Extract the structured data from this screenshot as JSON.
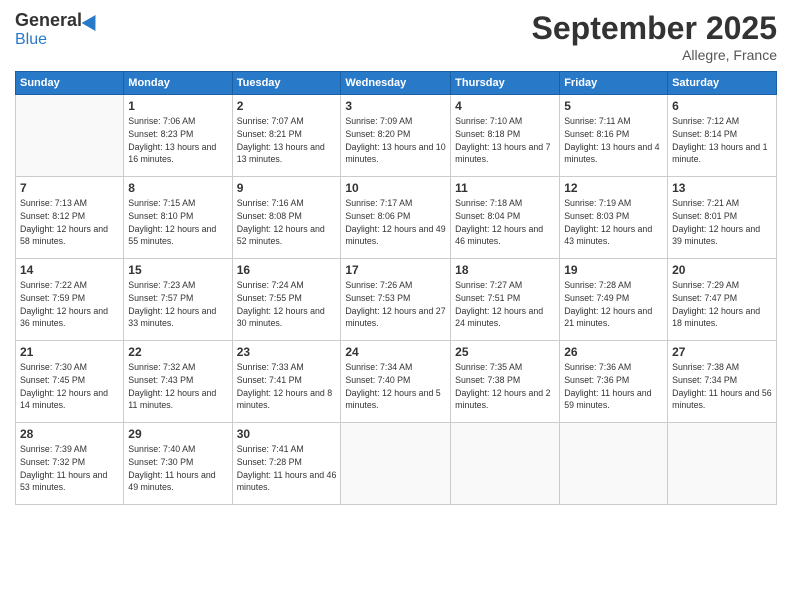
{
  "logo": {
    "general": "General",
    "blue": "Blue"
  },
  "header": {
    "month": "September 2025",
    "location": "Allegre, France"
  },
  "weekdays": [
    "Sunday",
    "Monday",
    "Tuesday",
    "Wednesday",
    "Thursday",
    "Friday",
    "Saturday"
  ],
  "weeks": [
    [
      {
        "day": "",
        "sunrise": "",
        "sunset": "",
        "daylight": ""
      },
      {
        "day": "1",
        "sunrise": "Sunrise: 7:06 AM",
        "sunset": "Sunset: 8:23 PM",
        "daylight": "Daylight: 13 hours and 16 minutes."
      },
      {
        "day": "2",
        "sunrise": "Sunrise: 7:07 AM",
        "sunset": "Sunset: 8:21 PM",
        "daylight": "Daylight: 13 hours and 13 minutes."
      },
      {
        "day": "3",
        "sunrise": "Sunrise: 7:09 AM",
        "sunset": "Sunset: 8:20 PM",
        "daylight": "Daylight: 13 hours and 10 minutes."
      },
      {
        "day": "4",
        "sunrise": "Sunrise: 7:10 AM",
        "sunset": "Sunset: 8:18 PM",
        "daylight": "Daylight: 13 hours and 7 minutes."
      },
      {
        "day": "5",
        "sunrise": "Sunrise: 7:11 AM",
        "sunset": "Sunset: 8:16 PM",
        "daylight": "Daylight: 13 hours and 4 minutes."
      },
      {
        "day": "6",
        "sunrise": "Sunrise: 7:12 AM",
        "sunset": "Sunset: 8:14 PM",
        "daylight": "Daylight: 13 hours and 1 minute."
      }
    ],
    [
      {
        "day": "7",
        "sunrise": "Sunrise: 7:13 AM",
        "sunset": "Sunset: 8:12 PM",
        "daylight": "Daylight: 12 hours and 58 minutes."
      },
      {
        "day": "8",
        "sunrise": "Sunrise: 7:15 AM",
        "sunset": "Sunset: 8:10 PM",
        "daylight": "Daylight: 12 hours and 55 minutes."
      },
      {
        "day": "9",
        "sunrise": "Sunrise: 7:16 AM",
        "sunset": "Sunset: 8:08 PM",
        "daylight": "Daylight: 12 hours and 52 minutes."
      },
      {
        "day": "10",
        "sunrise": "Sunrise: 7:17 AM",
        "sunset": "Sunset: 8:06 PM",
        "daylight": "Daylight: 12 hours and 49 minutes."
      },
      {
        "day": "11",
        "sunrise": "Sunrise: 7:18 AM",
        "sunset": "Sunset: 8:04 PM",
        "daylight": "Daylight: 12 hours and 46 minutes."
      },
      {
        "day": "12",
        "sunrise": "Sunrise: 7:19 AM",
        "sunset": "Sunset: 8:03 PM",
        "daylight": "Daylight: 12 hours and 43 minutes."
      },
      {
        "day": "13",
        "sunrise": "Sunrise: 7:21 AM",
        "sunset": "Sunset: 8:01 PM",
        "daylight": "Daylight: 12 hours and 39 minutes."
      }
    ],
    [
      {
        "day": "14",
        "sunrise": "Sunrise: 7:22 AM",
        "sunset": "Sunset: 7:59 PM",
        "daylight": "Daylight: 12 hours and 36 minutes."
      },
      {
        "day": "15",
        "sunrise": "Sunrise: 7:23 AM",
        "sunset": "Sunset: 7:57 PM",
        "daylight": "Daylight: 12 hours and 33 minutes."
      },
      {
        "day": "16",
        "sunrise": "Sunrise: 7:24 AM",
        "sunset": "Sunset: 7:55 PM",
        "daylight": "Daylight: 12 hours and 30 minutes."
      },
      {
        "day": "17",
        "sunrise": "Sunrise: 7:26 AM",
        "sunset": "Sunset: 7:53 PM",
        "daylight": "Daylight: 12 hours and 27 minutes."
      },
      {
        "day": "18",
        "sunrise": "Sunrise: 7:27 AM",
        "sunset": "Sunset: 7:51 PM",
        "daylight": "Daylight: 12 hours and 24 minutes."
      },
      {
        "day": "19",
        "sunrise": "Sunrise: 7:28 AM",
        "sunset": "Sunset: 7:49 PM",
        "daylight": "Daylight: 12 hours and 21 minutes."
      },
      {
        "day": "20",
        "sunrise": "Sunrise: 7:29 AM",
        "sunset": "Sunset: 7:47 PM",
        "daylight": "Daylight: 12 hours and 18 minutes."
      }
    ],
    [
      {
        "day": "21",
        "sunrise": "Sunrise: 7:30 AM",
        "sunset": "Sunset: 7:45 PM",
        "daylight": "Daylight: 12 hours and 14 minutes."
      },
      {
        "day": "22",
        "sunrise": "Sunrise: 7:32 AM",
        "sunset": "Sunset: 7:43 PM",
        "daylight": "Daylight: 12 hours and 11 minutes."
      },
      {
        "day": "23",
        "sunrise": "Sunrise: 7:33 AM",
        "sunset": "Sunset: 7:41 PM",
        "daylight": "Daylight: 12 hours and 8 minutes."
      },
      {
        "day": "24",
        "sunrise": "Sunrise: 7:34 AM",
        "sunset": "Sunset: 7:40 PM",
        "daylight": "Daylight: 12 hours and 5 minutes."
      },
      {
        "day": "25",
        "sunrise": "Sunrise: 7:35 AM",
        "sunset": "Sunset: 7:38 PM",
        "daylight": "Daylight: 12 hours and 2 minutes."
      },
      {
        "day": "26",
        "sunrise": "Sunrise: 7:36 AM",
        "sunset": "Sunset: 7:36 PM",
        "daylight": "Daylight: 11 hours and 59 minutes."
      },
      {
        "day": "27",
        "sunrise": "Sunrise: 7:38 AM",
        "sunset": "Sunset: 7:34 PM",
        "daylight": "Daylight: 11 hours and 56 minutes."
      }
    ],
    [
      {
        "day": "28",
        "sunrise": "Sunrise: 7:39 AM",
        "sunset": "Sunset: 7:32 PM",
        "daylight": "Daylight: 11 hours and 53 minutes."
      },
      {
        "day": "29",
        "sunrise": "Sunrise: 7:40 AM",
        "sunset": "Sunset: 7:30 PM",
        "daylight": "Daylight: 11 hours and 49 minutes."
      },
      {
        "day": "30",
        "sunrise": "Sunrise: 7:41 AM",
        "sunset": "Sunset: 7:28 PM",
        "daylight": "Daylight: 11 hours and 46 minutes."
      },
      {
        "day": "",
        "sunrise": "",
        "sunset": "",
        "daylight": ""
      },
      {
        "day": "",
        "sunrise": "",
        "sunset": "",
        "daylight": ""
      },
      {
        "day": "",
        "sunrise": "",
        "sunset": "",
        "daylight": ""
      },
      {
        "day": "",
        "sunrise": "",
        "sunset": "",
        "daylight": ""
      }
    ]
  ]
}
